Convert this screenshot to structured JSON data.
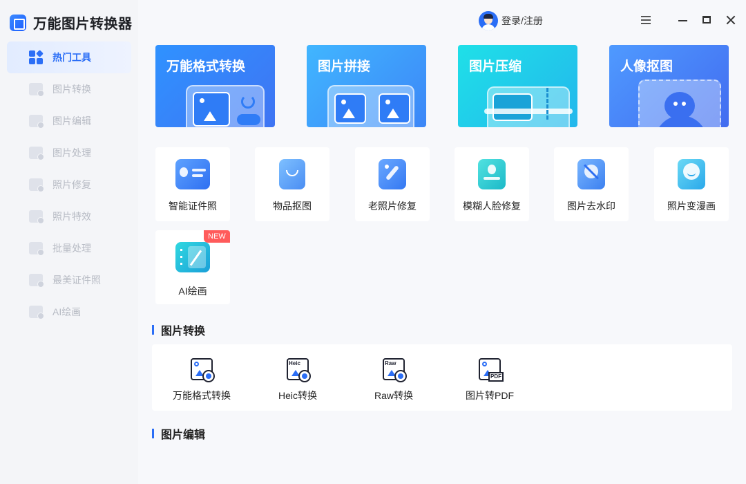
{
  "app": {
    "title": "万能图片转换器"
  },
  "header": {
    "login_label": "登录/注册"
  },
  "sidebar": {
    "items": [
      {
        "label": "热门工具"
      },
      {
        "label": "图片转换"
      },
      {
        "label": "图片编辑"
      },
      {
        "label": "图片处理"
      },
      {
        "label": "照片修复"
      },
      {
        "label": "照片特效"
      },
      {
        "label": "批量处理"
      },
      {
        "label": "最美证件照"
      },
      {
        "label": "AI绘画"
      }
    ]
  },
  "banners": [
    {
      "title": "万能格式转换"
    },
    {
      "title": "图片拼接"
    },
    {
      "title": "图片压缩"
    },
    {
      "title": "人像抠图"
    }
  ],
  "tools": [
    {
      "label": "智能证件照"
    },
    {
      "label": "物品抠图"
    },
    {
      "label": "老照片修复"
    },
    {
      "label": "模糊人脸修复"
    },
    {
      "label": "图片去水印"
    },
    {
      "label": "照片变漫画"
    },
    {
      "label": "AI绘画",
      "badge": "NEW"
    }
  ],
  "sections": {
    "conversion": {
      "title": "图片转换",
      "items": [
        {
          "label": "万能格式转换",
          "tag": ""
        },
        {
          "label": "Heic转换",
          "tag": "Heic"
        },
        {
          "label": "Raw转换",
          "tag": "Raw"
        },
        {
          "label": "图片转PDF",
          "tag": "PDF"
        }
      ]
    },
    "editing": {
      "title": "图片编辑"
    }
  },
  "colors": {
    "accent": "#2b6ef6",
    "badge": "#ff5b5b"
  }
}
